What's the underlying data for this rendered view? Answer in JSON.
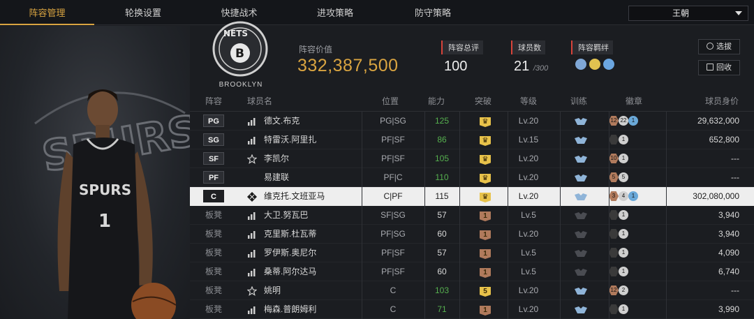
{
  "nav": {
    "tabs": [
      "阵容管理",
      "轮换设置",
      "快捷战术",
      "进攻策略",
      "防守策略"
    ],
    "active_tab": 0,
    "team_select": "王朝"
  },
  "header": {
    "logo_caption": "BROOKLYN",
    "lineup_value_label": "阵容价值",
    "lineup_value": "332,387,500",
    "rating_label": "阵容总评",
    "rating_value": "100",
    "players_label": "球员数",
    "players_value": "21",
    "players_max": "/300",
    "bond_label": "阵容羁绊",
    "buttons": {
      "pick": "选拔",
      "recall": "回收"
    }
  },
  "table": {
    "columns": [
      "阵容",
      "球员名",
      "位置",
      "能力",
      "突破",
      "等级",
      "训练",
      "徽章",
      "球员身价"
    ],
    "rows": [
      {
        "slot": "PG",
        "bench": false,
        "icon": "bars",
        "name": "德文.布克",
        "position": "PG|SG",
        "ability": "125",
        "ability_color": "#56b04f",
        "breakthrough": "crown",
        "brk_color": "#e8c24a",
        "level": "Lv.20",
        "train": "blue",
        "badges": [
          {
            "t": "12",
            "c": "#b07a5c"
          },
          {
            "t": "22",
            "c": "#cfcfcf"
          },
          {
            "t": "1",
            "c": "#6aa8d8"
          }
        ],
        "value": "29,632,000",
        "selected": false
      },
      {
        "slot": "SG",
        "bench": false,
        "icon": "bars",
        "name": "特雷沃.阿里扎",
        "position": "PF|SF",
        "ability": "86",
        "ability_color": "#56b04f",
        "breakthrough": "crown",
        "brk_color": "#e8c24a",
        "level": "Lv.15",
        "train": "blue",
        "badges": [
          {
            "t": "",
            "c": "#3a3a3a"
          },
          {
            "t": "1",
            "c": "#cfcfcf"
          }
        ],
        "value": "652,800",
        "selected": false
      },
      {
        "slot": "SF",
        "bench": false,
        "icon": "star",
        "name": "李凯尔",
        "position": "PF|SF",
        "ability": "105",
        "ability_color": "#56b04f",
        "breakthrough": "crown",
        "brk_color": "#e8c24a",
        "level": "Lv.20",
        "train": "blue",
        "badges": [
          {
            "t": "10",
            "c": "#b07a5c"
          },
          {
            "t": "1",
            "c": "#cfcfcf"
          }
        ],
        "value": "---",
        "selected": false
      },
      {
        "slot": "PF",
        "bench": false,
        "icon": "none",
        "name": "易建联",
        "position": "PF|C",
        "ability": "110",
        "ability_color": "#56b04f",
        "breakthrough": "crown",
        "brk_color": "#e8c24a",
        "level": "Lv.20",
        "train": "blue",
        "badges": [
          {
            "t": "5",
            "c": "#b07a5c"
          },
          {
            "t": "5",
            "c": "#cfcfcf"
          }
        ],
        "value": "---",
        "selected": false
      },
      {
        "slot": "C",
        "bench": false,
        "icon": "diamond",
        "name": "维克托.文班亚马",
        "position": "C|PF",
        "ability": "115",
        "ability_color": "#1c1c1c",
        "breakthrough": "crown",
        "brk_color": "#e8c24a",
        "level": "Lv.20",
        "train": "blue",
        "badges": [
          {
            "t": "3",
            "c": "#b07a5c"
          },
          {
            "t": "4",
            "c": "#cfcfcf"
          },
          {
            "t": "1",
            "c": "#6aa8d8"
          }
        ],
        "value": "302,080,000",
        "selected": true
      },
      {
        "slot": "板凳",
        "bench": true,
        "icon": "bars",
        "name": "大卫.努瓦巴",
        "position": "SF|SG",
        "ability": "57",
        "ability_color": "#d8d8d8",
        "breakthrough": "1",
        "brk_color": "#b07a5c",
        "level": "Lv.5",
        "train": "gray",
        "badges": [
          {
            "t": "",
            "c": "#3a3a3a"
          },
          {
            "t": "1",
            "c": "#cfcfcf"
          }
        ],
        "value": "3,940",
        "selected": false
      },
      {
        "slot": "板凳",
        "bench": true,
        "icon": "bars",
        "name": "克里斯.杜瓦蒂",
        "position": "PF|SG",
        "ability": "60",
        "ability_color": "#d8d8d8",
        "breakthrough": "1",
        "brk_color": "#b07a5c",
        "level": "Lv.20",
        "train": "gray",
        "badges": [
          {
            "t": "",
            "c": "#3a3a3a"
          },
          {
            "t": "1",
            "c": "#cfcfcf"
          }
        ],
        "value": "3,940",
        "selected": false
      },
      {
        "slot": "板凳",
        "bench": true,
        "icon": "bars",
        "name": "罗伊斯.奥尼尔",
        "position": "PF|SF",
        "ability": "57",
        "ability_color": "#d8d8d8",
        "breakthrough": "1",
        "brk_color": "#b07a5c",
        "level": "Lv.5",
        "train": "gray",
        "badges": [
          {
            "t": "",
            "c": "#3a3a3a"
          },
          {
            "t": "1",
            "c": "#cfcfcf"
          }
        ],
        "value": "4,090",
        "selected": false
      },
      {
        "slot": "板凳",
        "bench": true,
        "icon": "bars",
        "name": "桑蒂.阿尔达马",
        "position": "PF|SF",
        "ability": "60",
        "ability_color": "#d8d8d8",
        "breakthrough": "1",
        "brk_color": "#b07a5c",
        "level": "Lv.5",
        "train": "gray",
        "badges": [
          {
            "t": "",
            "c": "#3a3a3a"
          },
          {
            "t": "1",
            "c": "#cfcfcf"
          }
        ],
        "value": "6,740",
        "selected": false
      },
      {
        "slot": "板凳",
        "bench": true,
        "icon": "star",
        "name": "姚明",
        "position": "C",
        "ability": "103",
        "ability_color": "#56b04f",
        "breakthrough": "5",
        "brk_color": "#e8c24a",
        "level": "Lv.20",
        "train": "blue",
        "badges": [
          {
            "t": "12",
            "c": "#b07a5c"
          },
          {
            "t": "2",
            "c": "#cfcfcf"
          }
        ],
        "value": "---",
        "selected": false
      },
      {
        "slot": "板凳",
        "bench": true,
        "icon": "bars",
        "name": "梅森.普朗姆利",
        "position": "C",
        "ability": "71",
        "ability_color": "#56b04f",
        "breakthrough": "1",
        "brk_color": "#b07a5c",
        "level": "Lv.20",
        "train": "blue",
        "badges": [
          {
            "t": "",
            "c": "#3a3a3a"
          },
          {
            "t": "1",
            "c": "#cfcfcf"
          }
        ],
        "value": "3,990",
        "selected": false
      }
    ]
  },
  "colors": {
    "accent": "#d9a441",
    "flag": "#d8433a",
    "selected_row": "#eeeeee"
  },
  "icons": {
    "bars": "signal-bars-icon",
    "star": "star-outline-icon",
    "diamond": "diamond-grid-icon",
    "crown": "crown-shield-icon",
    "train_blue": "training-emblem-icon"
  }
}
